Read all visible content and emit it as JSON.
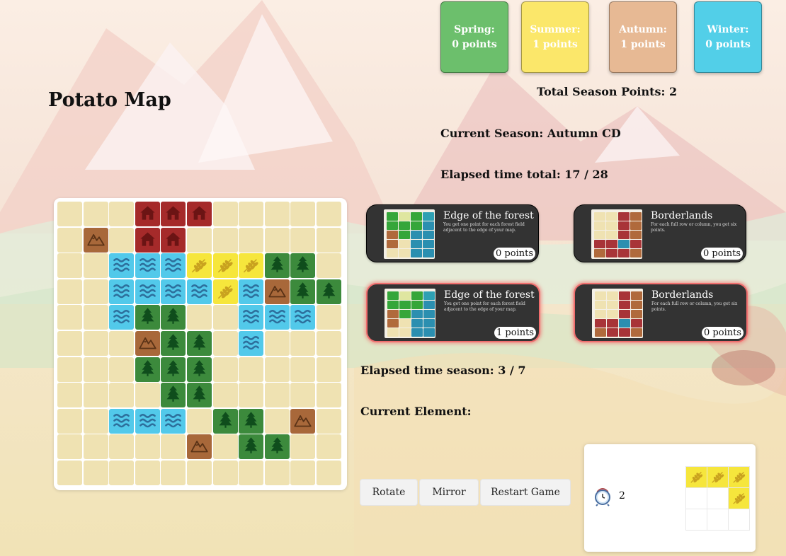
{
  "title": "Potato Map",
  "seasons": [
    {
      "name": "Spring:",
      "points": "0 points",
      "color": "#6cbf6c",
      "text_color": "#ffffff"
    },
    {
      "name": "Summer:",
      "points": "1 points",
      "color": "#fbe76a",
      "text_color": "#ffffff"
    },
    {
      "name": "Autumn:",
      "points": "1 points",
      "color": "#e7b994",
      "text_color": "#ffffff"
    },
    {
      "name": "Winter:",
      "points": "0 points",
      "color": "#52cfe8",
      "text_color": "#ffffff"
    }
  ],
  "total_season_points": "Total Season Points: 2",
  "current_season": "Current Season: Autumn CD",
  "elapsed_total": "Elapsed time total: 17 / 28",
  "elapsed_season": "Elapsed time season: 3 / 7",
  "current_element_label": "Current Element:",
  "cards": [
    {
      "title": "Edge of the forest",
      "desc": "You get one point for each forest field adjacent to the edge of your map.",
      "points": "0 points",
      "active": false,
      "kind": "forest"
    },
    {
      "title": "Borderlands",
      "desc": "For each full row or column, you get six points.",
      "points": "0 points",
      "active": false,
      "kind": "border"
    },
    {
      "title": "Edge of the forest",
      "desc": "You get one point for each forest field adjacent to the edge of your map.",
      "points": "1 points",
      "active": true,
      "kind": "forest"
    },
    {
      "title": "Borderlands",
      "desc": "For each full row or column, you get six points.",
      "points": "0 points",
      "active": true,
      "kind": "border"
    }
  ],
  "buttons": {
    "rotate": "Rotate",
    "mirror": "Mirror",
    "restart": "Restart Game"
  },
  "current_element": {
    "time": "2",
    "type": "field",
    "shape": [
      [
        1,
        1,
        1
      ],
      [
        0,
        0,
        1
      ],
      [
        0,
        0,
        0
      ]
    ]
  },
  "map": [
    [
      "E",
      "E",
      "E",
      "H",
      "H",
      "H",
      "E",
      "E",
      "E",
      "E",
      "E"
    ],
    [
      "E",
      "M",
      "E",
      "H",
      "H",
      "E",
      "E",
      "E",
      "E",
      "E",
      "E"
    ],
    [
      "E",
      "E",
      "W",
      "W",
      "W",
      "F",
      "F",
      "F",
      "T",
      "T",
      "E"
    ],
    [
      "E",
      "E",
      "W",
      "W",
      "W",
      "W",
      "F",
      "W",
      "M",
      "T",
      "T"
    ],
    [
      "E",
      "E",
      "W",
      "T",
      "T",
      "E",
      "E",
      "W",
      "W",
      "W",
      "E"
    ],
    [
      "E",
      "E",
      "E",
      "M",
      "T",
      "T",
      "E",
      "W",
      "E",
      "E",
      "E"
    ],
    [
      "E",
      "E",
      "E",
      "T",
      "T",
      "T",
      "E",
      "E",
      "E",
      "E",
      "E"
    ],
    [
      "E",
      "E",
      "E",
      "E",
      "T",
      "T",
      "E",
      "E",
      "E",
      "E",
      "E"
    ],
    [
      "E",
      "E",
      "W",
      "W",
      "W",
      "E",
      "T",
      "T",
      "E",
      "M",
      "E"
    ],
    [
      "E",
      "E",
      "E",
      "E",
      "E",
      "M",
      "E",
      "T",
      "T",
      "E",
      "E"
    ],
    [
      "E",
      "E",
      "E",
      "E",
      "E",
      "E",
      "E",
      "E",
      "E",
      "E",
      "E"
    ]
  ],
  "terrain_legend": {
    "E": "empty",
    "H": "house",
    "M": "mountain",
    "W": "water",
    "F": "field",
    "T": "forest"
  },
  "colors": {
    "house": "#a52a2a",
    "mountain": "#a8683a",
    "water": "#52c9ea",
    "field": "#f6e63c",
    "forest": "#3c8a3c",
    "empty": "#efe2b2",
    "card_bg": "#333333",
    "card_active_border": "#f06e6e"
  }
}
